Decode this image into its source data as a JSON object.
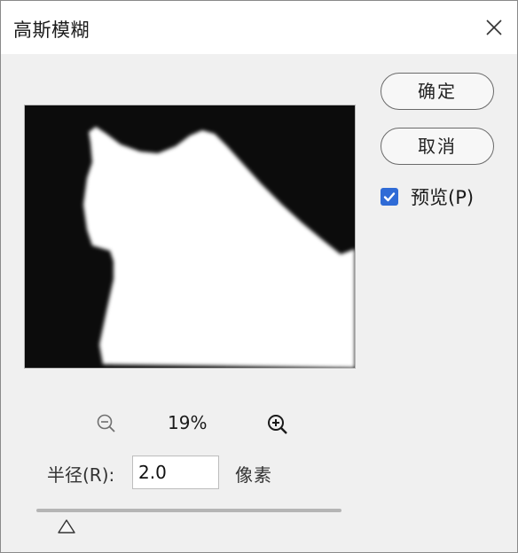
{
  "dialog": {
    "title": "高斯模糊",
    "close_icon": "close-icon"
  },
  "buttons": {
    "ok_label": "确定",
    "cancel_label": "取消"
  },
  "preview": {
    "label": "预览(P)",
    "checked": true,
    "checkbox_color": "#2f6bd6"
  },
  "zoom": {
    "zoom_out_icon": "zoom-out-icon",
    "level": "19%",
    "zoom_in_icon": "zoom-in-icon"
  },
  "radius": {
    "label": "半径(R):",
    "value": "2.0",
    "unit": "像素"
  },
  "slider": {
    "thumb_icon": "triangle-thumb-icon"
  }
}
